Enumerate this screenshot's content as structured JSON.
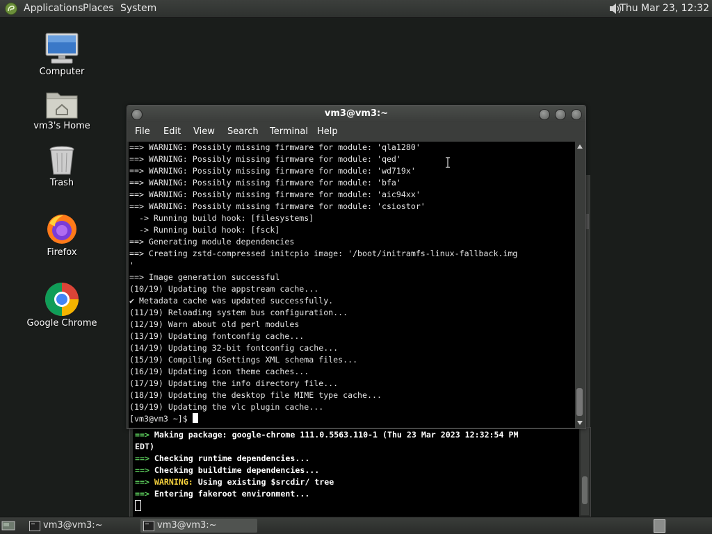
{
  "top_panel": {
    "applications": "Applications",
    "places": "Places",
    "system": "System",
    "clock": "Thu Mar 23, 12:32"
  },
  "desktop": {
    "icons": [
      {
        "label": "Computer",
        "icon": "computer-icon"
      },
      {
        "label": "vm3's Home",
        "icon": "home-folder-icon"
      },
      {
        "label": "Trash",
        "icon": "trash-icon"
      },
      {
        "label": "Firefox",
        "icon": "firefox-icon"
      },
      {
        "label": "Google Chrome",
        "icon": "chrome-icon"
      }
    ]
  },
  "terminal": {
    "title": "vm3@vm3:~",
    "menu": [
      "File",
      "Edit",
      "View",
      "Search",
      "Terminal",
      "Help"
    ],
    "lines": [
      "==> WARNING: Possibly missing firmware for module: 'qla1280'",
      "==> WARNING: Possibly missing firmware for module: 'qed'",
      "==> WARNING: Possibly missing firmware for module: 'wd719x'",
      "==> WARNING: Possibly missing firmware for module: 'bfa'",
      "==> WARNING: Possibly missing firmware for module: 'aic94xx'",
      "==> WARNING: Possibly missing firmware for module: 'csiostor'",
      "  -> Running build hook: [filesystems]",
      "  -> Running build hook: [fsck]",
      "==> Generating module dependencies",
      "==> Creating zstd-compressed initcpio image: '/boot/initramfs-linux-fallback.img",
      "'",
      "==> Image generation successful",
      "(10/19) Updating the appstream cache...",
      "✔ Metadata cache was updated successfully.",
      "(11/19) Reloading system bus configuration...",
      "(12/19) Warn about old perl modules",
      "(13/19) Updating fontconfig cache...",
      "(14/19) Updating 32-bit fontconfig cache...",
      "(15/19) Compiling GSettings XML schema files...",
      "(16/19) Updating icon theme caches...",
      "(17/19) Updating the info directory file...",
      "(18/19) Updating the desktop file MIME type cache...",
      "(19/19) Updating the vlc plugin cache..."
    ],
    "prompt": "[vm3@vm3 ~]$ "
  },
  "back_terminal": {
    "arrow": "==>",
    "line1": " Making package: google-chrome 111.0.5563.110-1 (Thu 23 Mar 2023 12:32:54 PM",
    "line1b": "EDT)",
    "line2": " Checking runtime dependencies...",
    "line3": " Checking buildtime dependencies...",
    "warning_label": " WARNING:",
    "line4": " Using existing $srcdir/ tree",
    "line5": " Entering fakeroot environment..."
  },
  "taskbar": {
    "items": [
      {
        "label": "vm3@vm3:~",
        "active": false
      },
      {
        "label": "vm3@vm3:~",
        "active": true
      }
    ]
  }
}
